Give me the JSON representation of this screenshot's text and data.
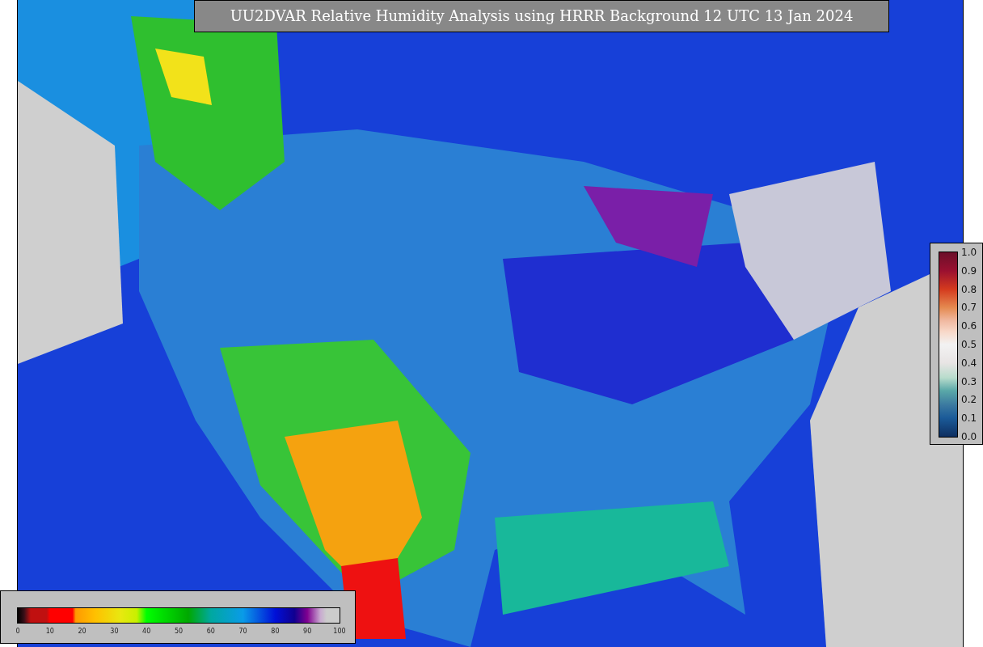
{
  "title": "UU2DVAR Relative Humidity Analysis using HRRR Background 12 UTC 13 Jan 2024",
  "humidity_colorbar": {
    "ticks": [
      "0",
      "10",
      "20",
      "30",
      "40",
      "50",
      "60",
      "70",
      "80",
      "90",
      "100"
    ]
  },
  "station_colorbar": {
    "ticks": [
      "1.0",
      "0.9",
      "0.8",
      "0.7",
      "0.6",
      "0.5",
      "0.4",
      "0.3",
      "0.2",
      "0.1",
      "0.0"
    ]
  }
}
